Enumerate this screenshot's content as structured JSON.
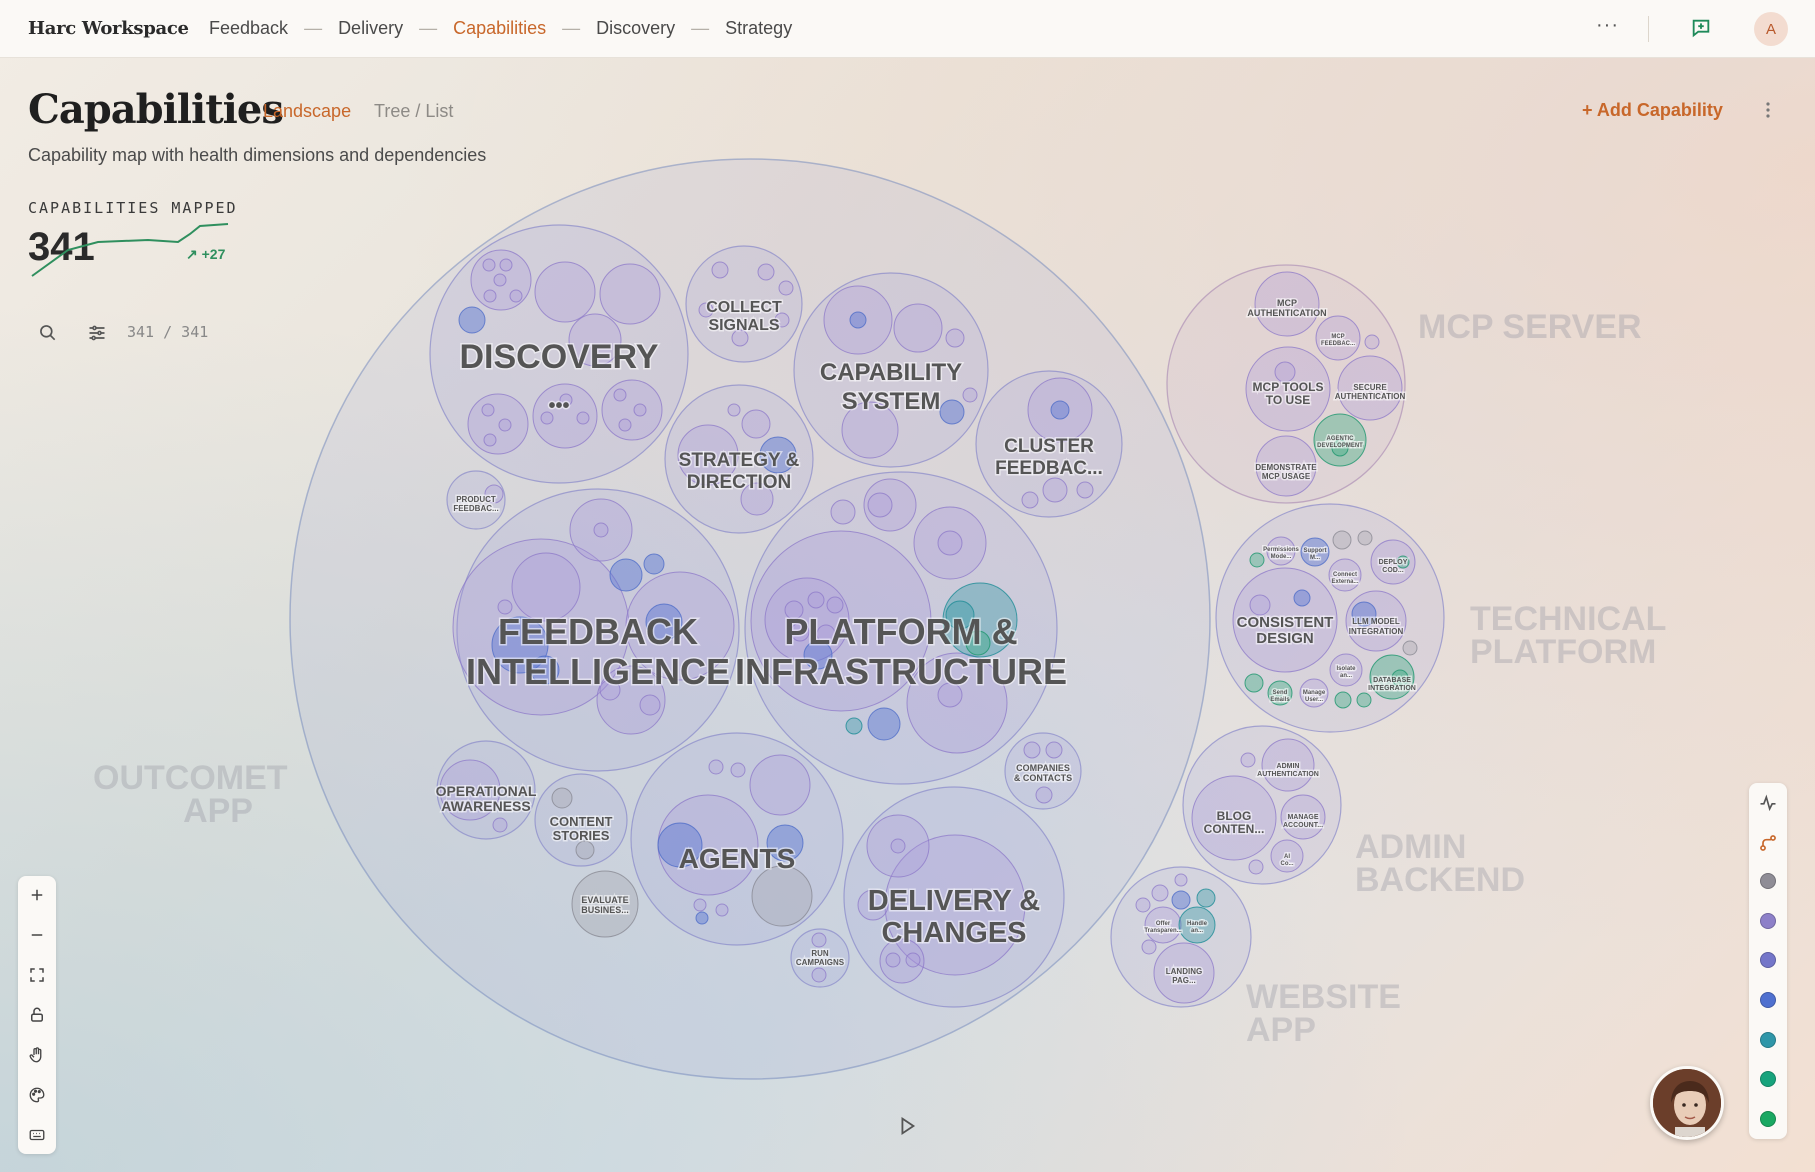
{
  "app": {
    "brand": "Harc Workspace",
    "avatar_initial": "A",
    "more": "···"
  },
  "nav": {
    "items": [
      "Feedback",
      "Delivery",
      "Capabilities",
      "Discovery",
      "Strategy"
    ],
    "active": "Capabilities",
    "separator": "—"
  },
  "page": {
    "title": "Capabilities",
    "views": [
      "Landscape",
      "Tree / List"
    ],
    "active_view": "Landscape",
    "subtitle": "Capability map with health dimensions and dependencies",
    "add_button": "+ Add Capability"
  },
  "metric": {
    "label": "CAPABILITIES MAPPED",
    "value": "341",
    "delta": "↗ +27"
  },
  "filter": {
    "count": "341 / 341"
  },
  "landscape": {
    "region_labels": [
      {
        "key": "outcomet",
        "lines": [
          "OUTCOMET",
          "APP"
        ]
      },
      {
        "key": "mcp",
        "lines": [
          "MCP SERVER"
        ]
      },
      {
        "key": "technical",
        "lines": [
          "TECHNICAL",
          "PLATFORM"
        ]
      },
      {
        "key": "admin",
        "lines": [
          "ADMIN",
          "BACKEND"
        ]
      },
      {
        "key": "website",
        "lines": [
          "WEBSITE",
          "APP"
        ]
      }
    ],
    "outcomet_groups": {
      "discovery": "DISCOVERY",
      "collect": [
        "COLLECT",
        "SIGNALS"
      ],
      "capability": [
        "CAPABILITY",
        "SYSTEM"
      ],
      "strategy": [
        "STRATEGY &",
        "DIRECTION"
      ],
      "cluster": [
        "CLUSTER",
        "FEEDBAC..."
      ],
      "product": [
        "PRODUCT",
        "FEEDBAC..."
      ],
      "feedback": [
        "FEEDBACK",
        "INTELLIGENCE"
      ],
      "platform": [
        "PLATFORM &",
        "INFRASTRUCTURE"
      ],
      "operational": [
        "OPERATIONAL",
        "AWARENESS"
      ],
      "content": [
        "CONTENT",
        "STORIES"
      ],
      "agents": "AGENTS",
      "companies": [
        "COMPANIES",
        "& CONTACTS"
      ],
      "evaluate": [
        "EVALUATE",
        "BUSINES..."
      ],
      "delivery": [
        "DELIVERY &",
        "CHANGES"
      ],
      "run": [
        "RUN",
        "CAMPAIGNS"
      ]
    },
    "mcp_groups": {
      "auth": [
        "MCP",
        "AUTHENTICATION"
      ],
      "feed": [
        "MCP",
        "FEEDBAC..."
      ],
      "tools": [
        "MCP TOOLS",
        "TO USE"
      ],
      "secure": [
        "SECURE",
        "AUTHENTICATION"
      ],
      "agentic": [
        "AGENTIC",
        "DEVELOPMENT"
      ],
      "demo": [
        "DEMONSTRATE",
        "MCP USAGE"
      ]
    },
    "tech_groups": {
      "permissions": [
        "Permissions",
        "Mode..."
      ],
      "support": [
        "Support",
        "M..."
      ],
      "connect": [
        "Connect",
        "Externa..."
      ],
      "deploy": [
        "DEPLOY",
        "COD..."
      ],
      "consistent": [
        "CONSISTENT",
        "DESIGN"
      ],
      "llm": [
        "LLM MODEL",
        "INTEGRATION"
      ],
      "isolate": [
        "Isolate",
        "an..."
      ],
      "database": [
        "DATABASE",
        "INTEGRATION"
      ],
      "send": [
        "Send",
        "Emails"
      ],
      "manage": [
        "Manage",
        "User..."
      ]
    },
    "admin_groups": {
      "auth": [
        "ADMIN",
        "AUTHENTICATION"
      ],
      "blog": [
        "BLOG",
        "CONTEN..."
      ],
      "manage": [
        "MANAGE",
        "ACCOUNT..."
      ],
      "ai": [
        "AI",
        "Co..."
      ]
    },
    "website_groups": {
      "offer": [
        "Offer",
        "Transparen..."
      ],
      "handle": [
        "Handle",
        "an..."
      ],
      "landing": [
        "LANDING",
        "PAG..."
      ]
    }
  },
  "legend": {
    "colors": [
      "#8f8d96",
      "#8d80c8",
      "#7476c9",
      "#4f70cf",
      "#2f96a8",
      "#17a37c",
      "#1aa862"
    ]
  }
}
